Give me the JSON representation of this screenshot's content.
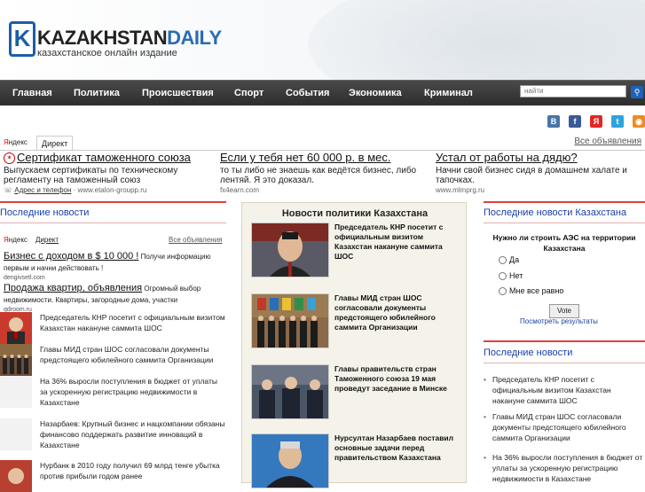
{
  "logo": {
    "letter": "K",
    "brand_main": "KAZAKHSTAN",
    "brand_accent": "DAILY",
    "tagline": "казахстанское онлайн издание"
  },
  "nav": {
    "items": [
      "Главная",
      "Политика",
      "Происшествия",
      "Спорт",
      "События",
      "Экономика",
      "Криминал"
    ]
  },
  "search": {
    "placeholder": "найти"
  },
  "social": {
    "items": [
      {
        "name": "vkontakte-icon",
        "glyph": "В",
        "color": "#4a75a8"
      },
      {
        "name": "facebook-icon",
        "glyph": "f",
        "color": "#3b5998"
      },
      {
        "name": "yandex-icon",
        "glyph": "Я",
        "color": "#e12626"
      },
      {
        "name": "twitter-icon",
        "glyph": "t",
        "color": "#2fa3dd"
      },
      {
        "name": "rss-icon",
        "glyph": "◉",
        "color": "#f08a24"
      }
    ]
  },
  "yad": {
    "yandex_first": "Я",
    "yandex_rest": "ндекс",
    "direkt": "Директ",
    "all_ads": "Все объявления",
    "ads": [
      {
        "title": "Сертификат таможенного союза",
        "text": "Выпускаем сертификаты по техническому регламенту на таможенный союз",
        "contact": "Адрес и телефон",
        "url": "www.etalon-groupp.ru"
      },
      {
        "title": "Если у тебя нет 60 000 р. в мес.",
        "text": "то ты либо не знаешь как ведётся бизнес, либо лентяй. Я это доказал.",
        "url": "fx4earn.com"
      },
      {
        "title": "Устал от работы на дядю?",
        "text": "Начни свой бизнес сидя в домашнем халате и тапочках.",
        "url": "www.mlmprg.ru"
      }
    ]
  },
  "left": {
    "heading": "Последние новости",
    "yad": {
      "yandex_first": "Я",
      "yandex_rest": "ндекс",
      "direkt": "Директ",
      "all_ads": "Все объявления"
    },
    "ads": [
      {
        "title": "Бизнес с доходом в $ 10 000 !",
        "text": " Получи информацию первым и начни действовать !",
        "url": "dengivsetl.com"
      },
      {
        "title": "Продажа квартир, объявления",
        "text": " Огромный выбор недвижимости. Квартиры, загородные дома, участки",
        "url": "qdroom.ru"
      }
    ],
    "news": [
      "Председатель КНР посетит с официальным визитом Казахстан накануне саммита ШОС",
      "Главы МИД стран ШОС согласовали документы предстоящего юбилейного саммита Организации",
      "На 36% выросли поступления в бюджет от уплаты за ускоренную регистрацию недвижимости в Казахстане",
      "Назарбаев: Крупный бизнес и нацкомпании обязаны финансово поддержать развитие инноваций в Казахстане",
      "Нурбанк в 2010 году получил 69 млрд тенге убытка против прибыли годом ранее"
    ]
  },
  "middle": {
    "heading": "Новости политики Казахстана",
    "items": [
      "Председатель КНР посетит с официальным визитом Казахстан накануне саммита ШОС",
      "Главы МИД стран ШОС согласовали документы предстоящего юбилейного саммита Организации",
      "Главы правительств стран Таможенного союза 19 мая проведут заседание в Минске",
      "Нурсултан Назарбаев поставил основные задачи перед правительством Казахстана"
    ]
  },
  "right": {
    "heading_kz": "Последние новости Казахстана",
    "poll_question": "Нужно ли строить АЭС на территории Казахстана",
    "poll_options": [
      "Да",
      "Нет",
      "Мне все равно"
    ],
    "vote": "Vote",
    "results": "Посмотреть результаты",
    "heading_news": "Последние новости",
    "news": [
      "Председатель КНР посетит с официальным визитом Казахстан накануне саммита ШОС",
      "Главы МИД стран ШОС согласовали документы предстоящего юбилейного саммита Организации",
      "На 36% выросли поступления в бюджет от уплаты за ускоренную регистрацию недвижимости в Казахстане"
    ]
  }
}
